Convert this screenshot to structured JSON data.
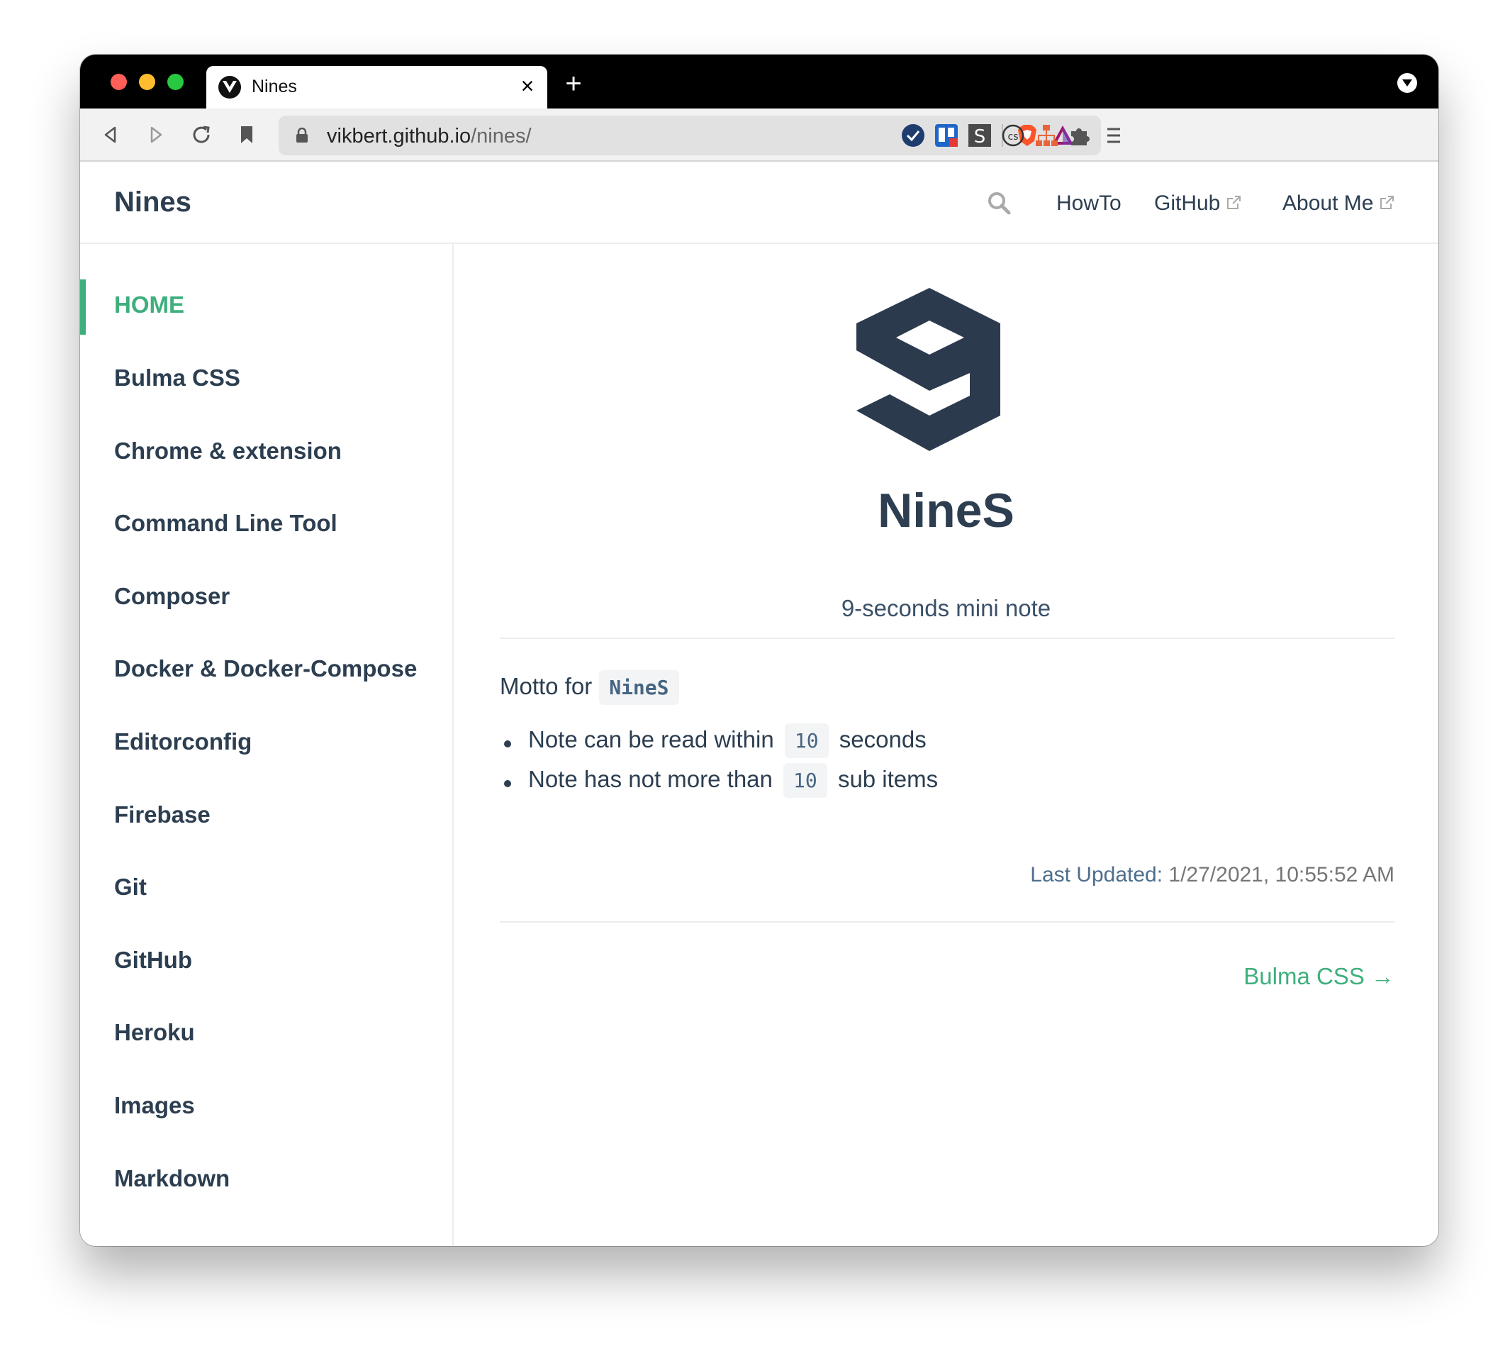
{
  "browser": {
    "tab_title": "Nines",
    "tab_close": "×",
    "new_tab": "+",
    "url_host": "vikbert.github.io",
    "url_path": "/nines/"
  },
  "navbar": {
    "site_title": "Nines",
    "links": [
      {
        "label": "HowTo",
        "external": false
      },
      {
        "label": "GitHub",
        "external": true
      },
      {
        "label": "About Me",
        "external": true
      }
    ]
  },
  "sidebar": {
    "items": [
      {
        "label": "HOME",
        "active": true
      },
      {
        "label": "Bulma CSS"
      },
      {
        "label": "Chrome & extension"
      },
      {
        "label": "Command Line Tool"
      },
      {
        "label": "Composer"
      },
      {
        "label": "Docker & Docker-Compose"
      },
      {
        "label": "Editorconfig"
      },
      {
        "label": "Firebase"
      },
      {
        "label": "Git"
      },
      {
        "label": "GitHub"
      },
      {
        "label": "Heroku"
      },
      {
        "label": "Images"
      },
      {
        "label": "Markdown"
      }
    ]
  },
  "hero": {
    "title": "NineS",
    "description": "9-seconds mini note"
  },
  "content": {
    "motto_label": "Motto for",
    "motto_code": "NineS",
    "bullets": [
      {
        "before": "Note can be read within",
        "code": "10",
        "after": "seconds"
      },
      {
        "before": "Note has not more than",
        "code": "10",
        "after": "sub items"
      }
    ],
    "last_updated_label": "Last Updated:",
    "last_updated_value": "1/27/2021, 10:55:52 AM",
    "next_link": "Bulma CSS →"
  },
  "colors": {
    "accent": "#3eaf7c",
    "text": "#2c3e50",
    "logo": "#2c3a4e"
  },
  "icons": [
    "vue-favicon-icon",
    "close-icon",
    "plus-icon",
    "tab-menu-icon",
    "back-icon",
    "forward-icon",
    "reload-icon",
    "bookmark-icon",
    "lock-icon",
    "brave-shield-icon",
    "brave-rewards-icon",
    "check-extension-icon",
    "trello-extension-icon",
    "s-extension-icon",
    "cs-extension-icon",
    "sitemap-extension-icon",
    "puzzle-icon",
    "menu-icon",
    "search-icon",
    "external-link-icon",
    "nines-logo-icon"
  ]
}
